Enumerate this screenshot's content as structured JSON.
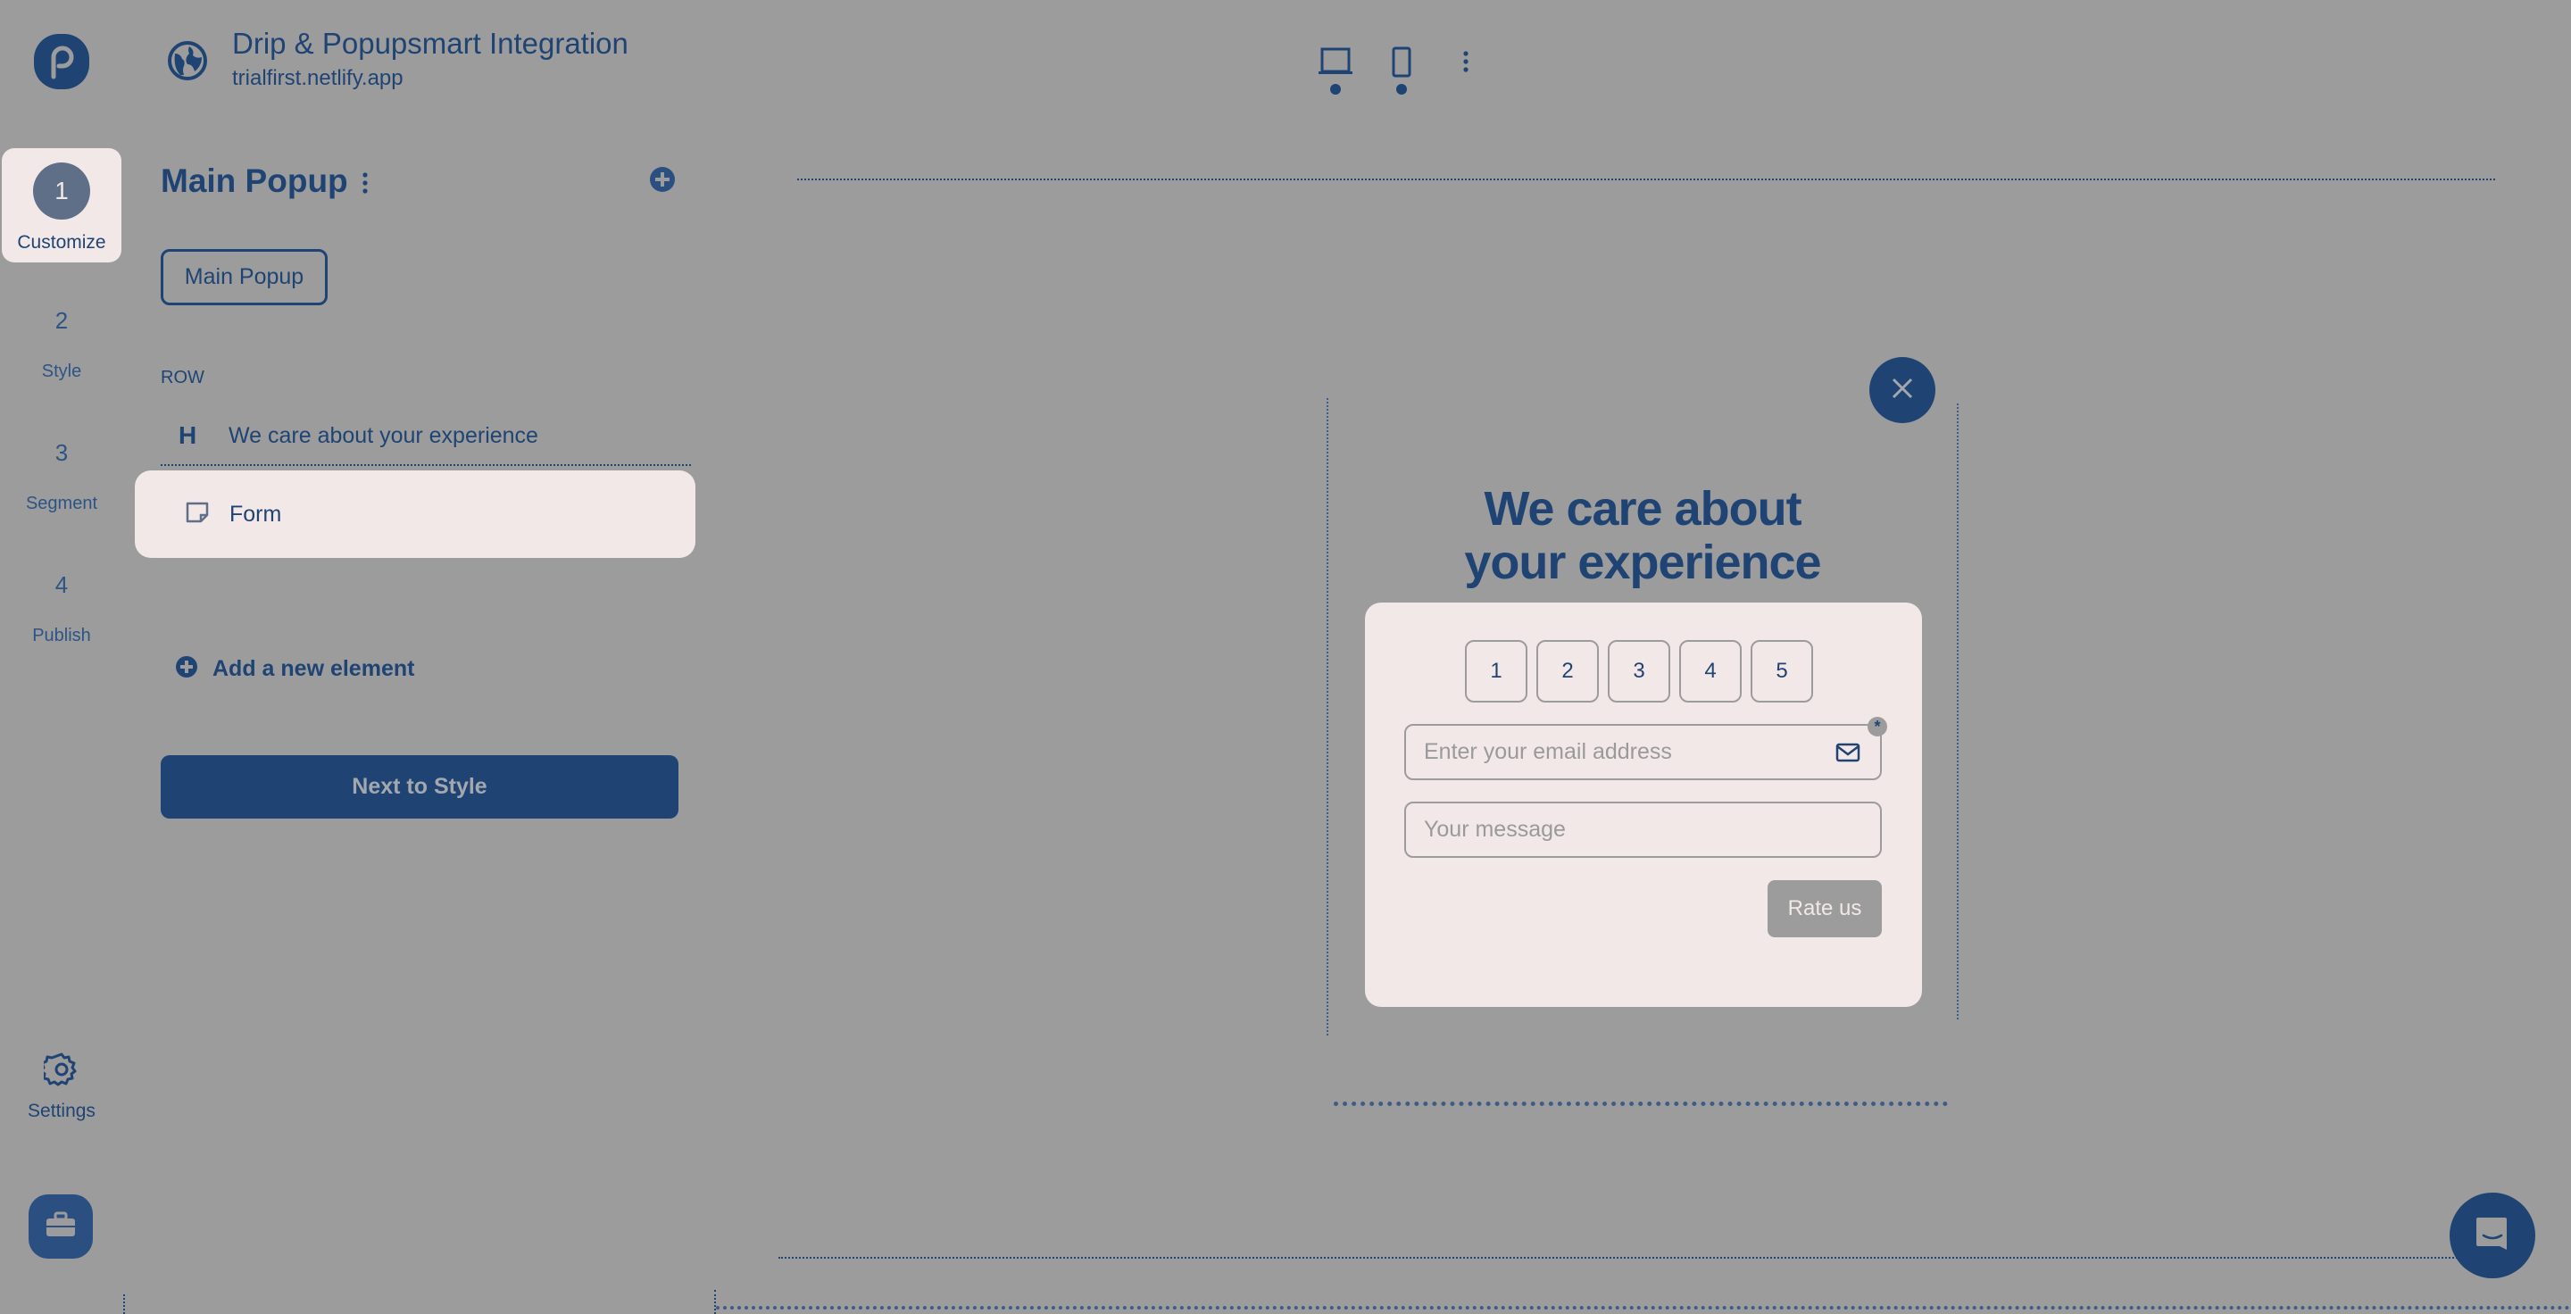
{
  "header": {
    "title": "Drip & Popupsmart Integration",
    "url": "trialfirst.netlify.app",
    "device_buttons": [
      {
        "name": "desktop-icon",
        "active": true
      },
      {
        "name": "mobile-icon",
        "active": true
      }
    ]
  },
  "steps": [
    {
      "number": "1",
      "label": "Customize",
      "active": true
    },
    {
      "number": "2",
      "label": "Style",
      "active": false
    },
    {
      "number": "3",
      "label": "Segment",
      "active": false
    },
    {
      "number": "4",
      "label": "Publish",
      "active": false
    }
  ],
  "rail_bottom": {
    "settings_label": "Settings"
  },
  "panel": {
    "title": "Main Popup",
    "chip_label": "Main Popup",
    "row_label": "ROW",
    "elements": [
      {
        "type": "heading",
        "icon": "H",
        "label": "We care about your experience",
        "selected": false
      },
      {
        "type": "form",
        "icon": "form-icon",
        "label": "Form",
        "selected": true
      }
    ],
    "add_element_label": "Add a new element",
    "next_button_label": "Next to Style"
  },
  "popup": {
    "heading_line1": "We care about",
    "heading_line2": "your experience",
    "ratings": [
      "1",
      "2",
      "3",
      "4",
      "5"
    ],
    "email_placeholder": "Enter your email address",
    "email_value": "",
    "message_placeholder": "Your message",
    "message_value": "",
    "required_marker": "*",
    "submit_label": "Rate us"
  },
  "colors": {
    "background": "#9c9c9c",
    "primary": "#1f4473",
    "highlight": "#f3e8e8"
  }
}
